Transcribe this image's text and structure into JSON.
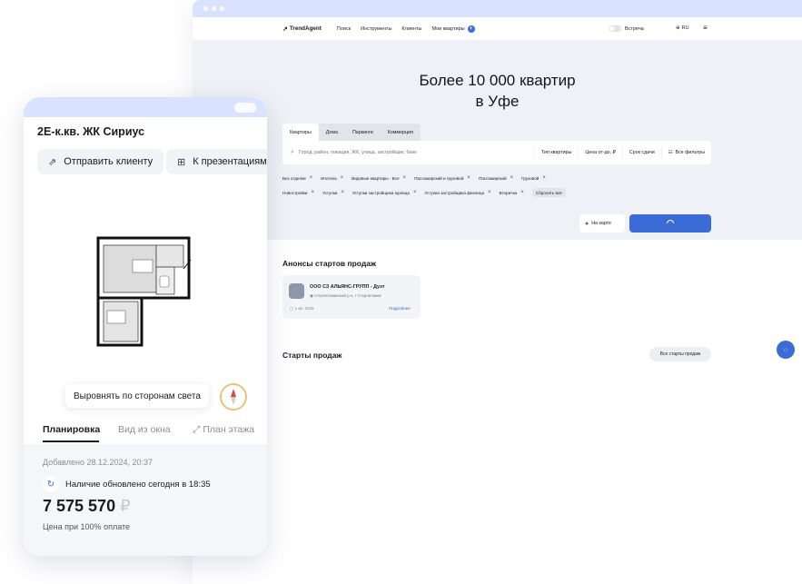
{
  "desktop": {
    "logo": "TrendAgent",
    "nav": [
      "Поиск",
      "Инструменты",
      "Клиенты",
      "Мои квартиры"
    ],
    "meeting_label": "Встреча",
    "lang": "RU",
    "hero_title": "Более  10 000 квартир\nв Уфе",
    "tabs": [
      "Квартиры",
      "Дома",
      "Паркинги",
      "Коммерция"
    ],
    "search_placeholder": "Город, район, локация, ЖК, улица, застройщик, банк",
    "filters": {
      "type": "Тип квартиры",
      "price": "Цена от-до, ₽",
      "deadline": "Срок сдачи",
      "all": "Все фильтры"
    },
    "chips": [
      "Без отделки",
      "Ипотека",
      "Видовые квартиры - Все",
      "Пассажирский и грузовой",
      "Пассажирский",
      "Грузовой",
      "Новостройки",
      "Уступки",
      "Уступки застройщика юрлица",
      "Уступки застройщика физлица",
      "Вторичка"
    ],
    "reset_chip": "Сбросить всё",
    "map_button": "На карте",
    "announcements_title": "Анонсы стартов продаж",
    "announcement": {
      "title": "ООО СЗ АЛЬЯНС-ГРУПП - Дуэт",
      "address": "Стерлитамакский р-н, г Стерлитамак",
      "date": "1 кв. 2025",
      "more": "Подробнее"
    },
    "starts_title": "Старты продаж",
    "all_starts": "Все старты продаж"
  },
  "mobile": {
    "title": "2Е-к.кв. ЖК Сириус",
    "send_button": "Отправить клиенту",
    "presentation_button": "К презентациям",
    "align_label": "Выровнять по сторонам света",
    "tabs": [
      "Планировка",
      "Вид из окна",
      "План этажа"
    ],
    "added": "Добавлено 28.12.2024, 20:37",
    "updated": "Наличие обновлено сегодня в 18:35",
    "price": "7 575 570",
    "currency": "₽",
    "price_note": "Цена при 100% оплате"
  },
  "colors": {
    "accent": "#3a6bd6",
    "browser_bar": "#d9e2ff",
    "hero_bg": "#eff1f6"
  },
  "icons": [
    "search-icon",
    "filter-icon",
    "map-pin-icon",
    "close-icon",
    "send-icon",
    "grid-plus-icon",
    "compass-icon",
    "refresh-icon",
    "chat-icon",
    "globe-icon",
    "menu-icon"
  ]
}
